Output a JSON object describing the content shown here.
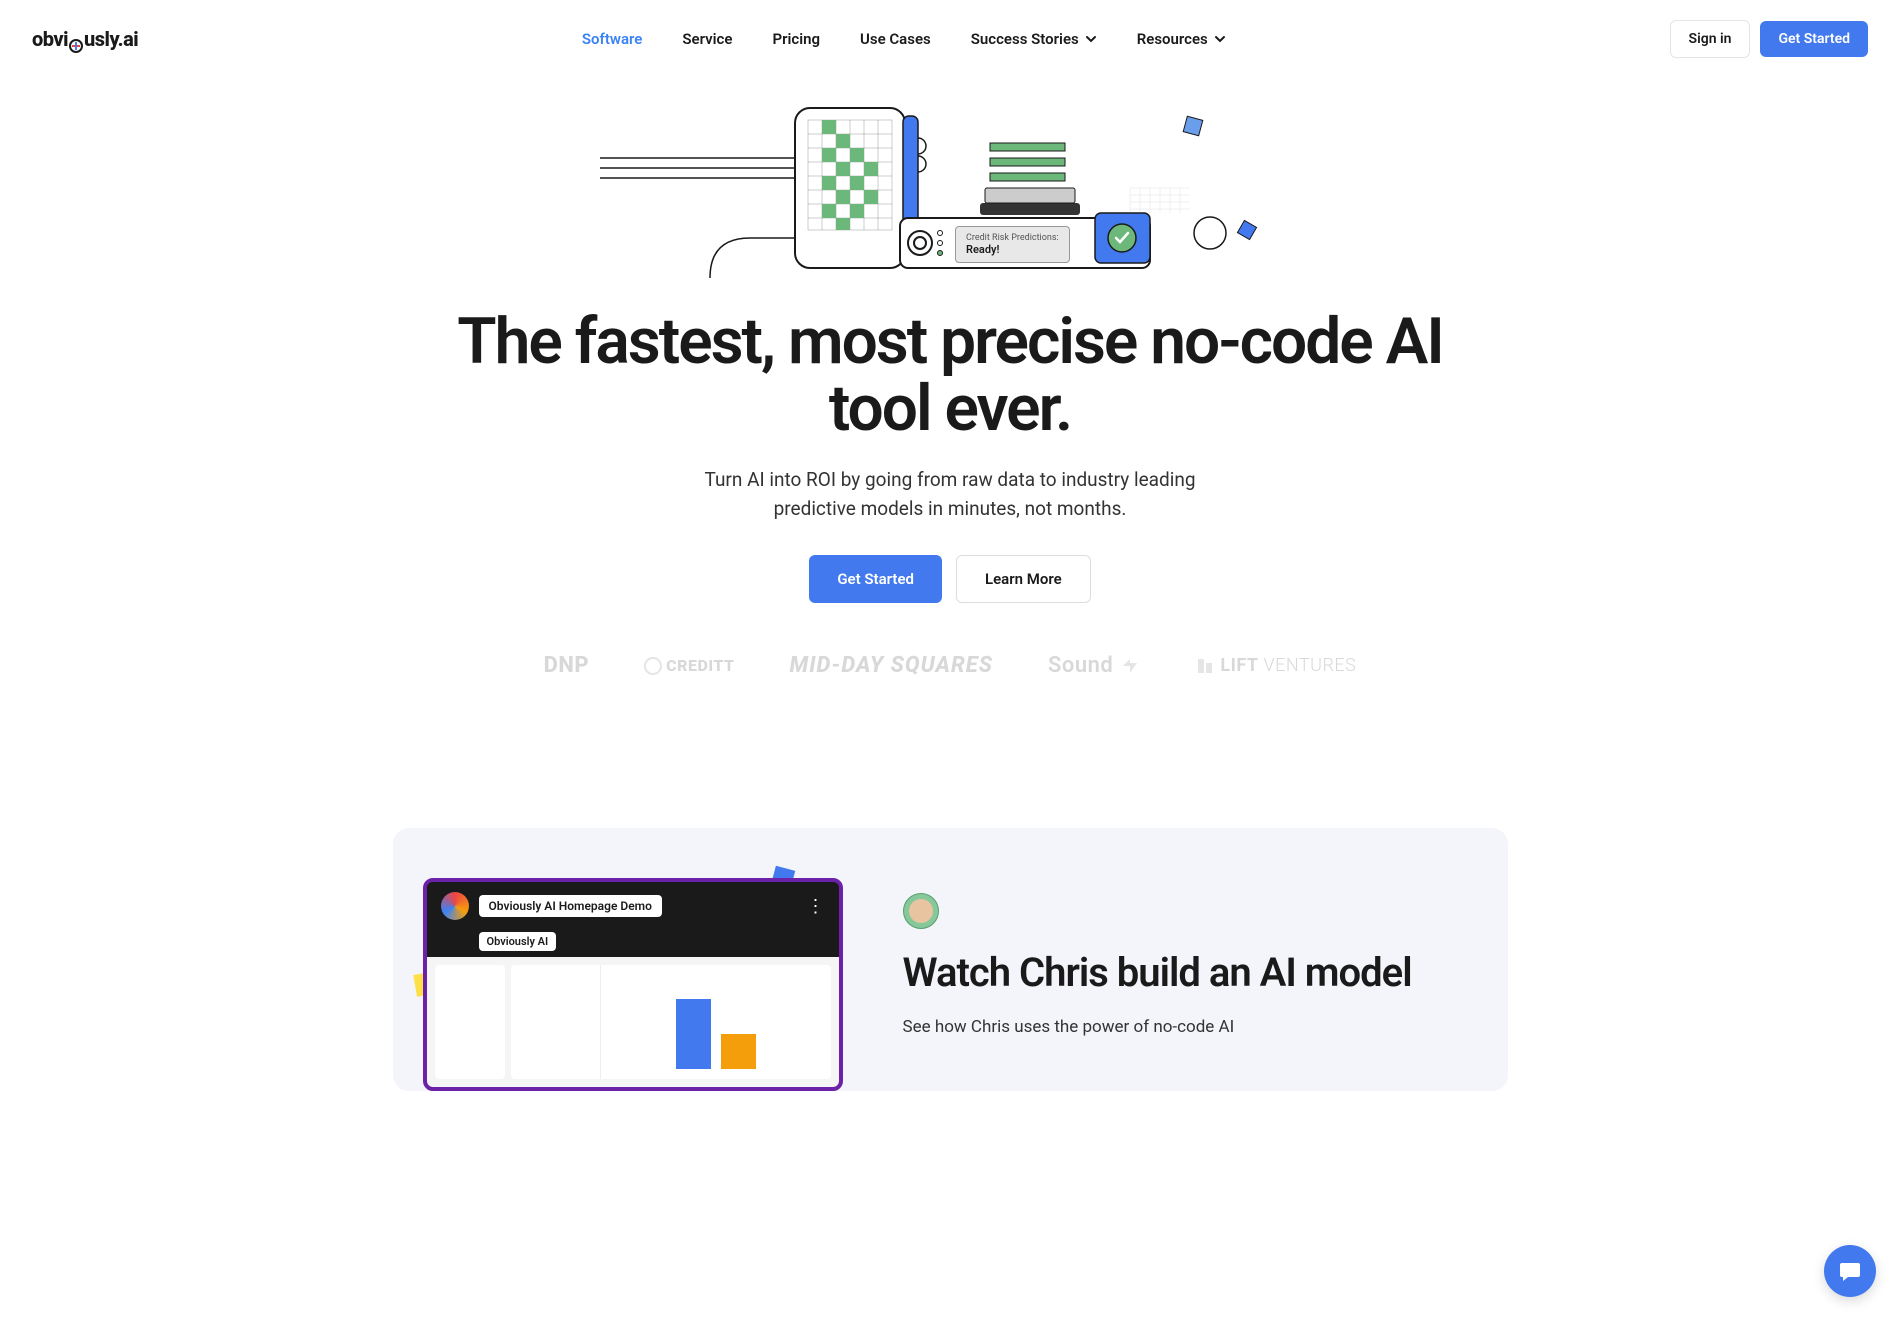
{
  "brand": {
    "name_pre": "obvi",
    "name_post": "usly.ai"
  },
  "nav": {
    "items": [
      {
        "label": "Software",
        "active": true,
        "dropdown": false
      },
      {
        "label": "Service",
        "active": false,
        "dropdown": false
      },
      {
        "label": "Pricing",
        "active": false,
        "dropdown": false
      },
      {
        "label": "Use Cases",
        "active": false,
        "dropdown": false
      },
      {
        "label": "Success Stories",
        "active": false,
        "dropdown": true
      },
      {
        "label": "Resources",
        "active": false,
        "dropdown": true
      }
    ]
  },
  "header_actions": {
    "signin": "Sign in",
    "get_started": "Get Started"
  },
  "hero": {
    "title": "The fastest, most precise no-code AI tool ever.",
    "subtitle": "Turn AI into ROI by going from raw data to industry leading predictive models in minutes, not months.",
    "primary_cta": "Get Started",
    "secondary_cta": "Learn More",
    "illustration_badge_label": "Credit Risk Predictions:",
    "illustration_badge_value": "Ready!"
  },
  "client_logos": [
    "DNP",
    "CREDITT",
    "MID-DAY SQUARES",
    "Sound",
    "LIFT VENTURES"
  ],
  "demo": {
    "player_title": "Obviously AI Homepage Demo",
    "player_subtitle": "Obviously AI",
    "heading": "Watch Chris build an AI model",
    "text": "See how Chris uses the power of no-code AI"
  }
}
